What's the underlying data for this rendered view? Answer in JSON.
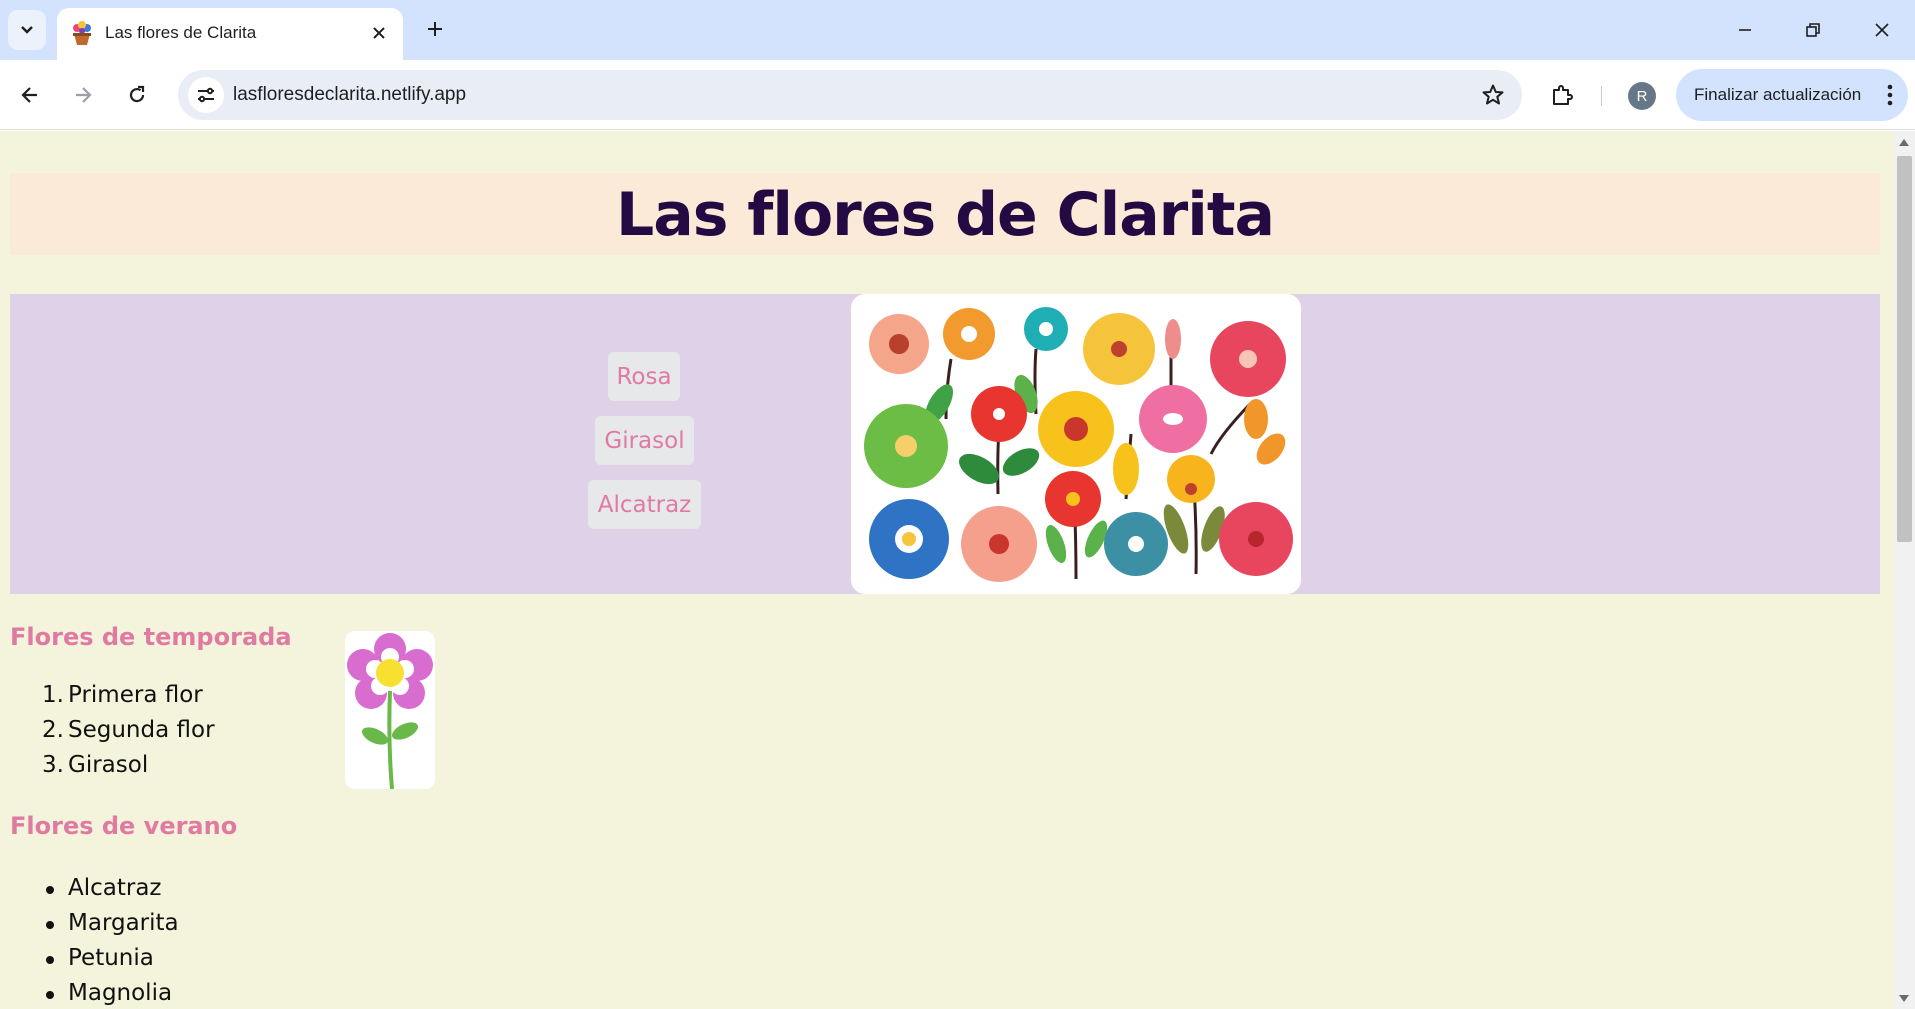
{
  "browser": {
    "tab": {
      "title": "Las flores de Clarita"
    },
    "url": "lasfloresdeclarita.netlify.app",
    "profile_initial": "R",
    "update_button": "Finalizar actualización"
  },
  "page": {
    "title": "Las flores de Clarita",
    "nav": [
      {
        "label": "Rosa"
      },
      {
        "label": "Girasol"
      },
      {
        "label": "Alcatraz"
      }
    ],
    "seasonal": {
      "heading": "Flores de temporada",
      "items": [
        {
          "num": "1.",
          "text": "Primera flor"
        },
        {
          "num": "2.",
          "text": "Segunda flor"
        },
        {
          "num": "3.",
          "text": "Girasol"
        }
      ]
    },
    "summer": {
      "heading": "Flores de verano",
      "items": [
        "Alcatraz",
        "Margarita",
        "Petunia",
        "Magnolia"
      ]
    }
  },
  "colors": {
    "page_bg": "#f4f4dc",
    "header_bg": "#fbead8",
    "title_color": "#230a42",
    "hero_bg": "#dfd2e8",
    "accent_pink": "#e07aa3"
  }
}
